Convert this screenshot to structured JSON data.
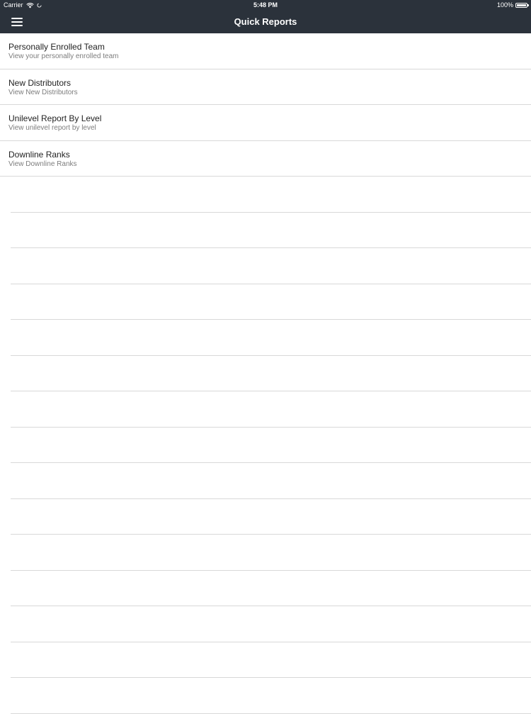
{
  "status_bar": {
    "carrier": "Carrier",
    "time": "5:48 PM",
    "battery": "100%"
  },
  "nav": {
    "title": "Quick Reports",
    "menu_icon": "hamburger-menu-icon"
  },
  "reports": [
    {
      "title": "Personally Enrolled Team",
      "subtitle": "View your personally enrolled team"
    },
    {
      "title": "New Distributors",
      "subtitle": "View New Distributors"
    },
    {
      "title": "Unilevel Report By Level",
      "subtitle": "View unilevel report by level"
    },
    {
      "title": "Downline Ranks",
      "subtitle": "View Downline Ranks"
    }
  ],
  "colors": {
    "header_background": "#2b323b",
    "separator": "#d8d8d8",
    "subtitle_text": "#7d7d7d"
  }
}
